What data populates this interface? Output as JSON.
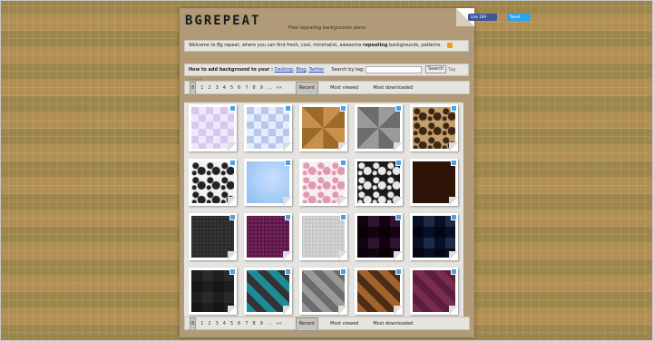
{
  "header": {
    "logo": "BGREPEAT",
    "tagline": "Free repeating backgrounds place"
  },
  "social": {
    "facebook": "Like 189",
    "twitter": "Tweet"
  },
  "welcome": {
    "prefix": "Welcome to Bg repeat, where you can find fresh, cool, minimalist, awesome",
    "bold": "repeating",
    "suffix": "backgrounds, patterns."
  },
  "howto": {
    "label": "How to add background to your :",
    "links": [
      "Desktop",
      "Blog",
      "Twitter"
    ],
    "search_label": "Search by tag:",
    "search_button": "Search",
    "tag_cloud": "Tag Cloud"
  },
  "pager": {
    "pages": [
      "8",
      "1",
      "2",
      "3",
      "4",
      "5",
      "6",
      "7",
      "8",
      "9",
      "...",
      "»»"
    ],
    "tabs": [
      "Recent",
      "Most viewed",
      "Most downloaded"
    ],
    "selected_tab": "Recent"
  },
  "tiles": [
    {
      "pattern": "diamond-lavender",
      "bg": "#d8c8f0",
      "fg": "#eee8fb"
    },
    {
      "pattern": "diamond-blue",
      "bg": "#b8c8ec",
      "fg": "#e4ecff"
    },
    {
      "pattern": "pinwheel-brown",
      "bg": "#9c6a2a",
      "fg": "#c89048"
    },
    {
      "pattern": "pinwheel-grey",
      "bg": "#6c6c6c",
      "fg": "#9a9a9a"
    },
    {
      "pattern": "floral-tan",
      "bg": "#c7a070",
      "fg": "#3a2814"
    },
    {
      "pattern": "floral-white",
      "bg": "#f2f2f2",
      "fg": "#222222"
    },
    {
      "pattern": "sky-blue",
      "bg": "#8fbdf0",
      "fg": "#c8e0ff"
    },
    {
      "pattern": "floral-pink",
      "bg": "#f7f0f0",
      "fg": "#e09ab0"
    },
    {
      "pattern": "lace-black",
      "bg": "#1a1a1a",
      "fg": "#e8e8e8"
    },
    {
      "pattern": "dark-brown",
      "bg": "#2d1406",
      "fg": "#3d1c0a"
    },
    {
      "pattern": "dark-grey",
      "bg": "#2a2a2a",
      "fg": "#3a3a3a"
    },
    {
      "pattern": "purple-dots",
      "bg": "#5a1846",
      "fg": "#7a2a64"
    },
    {
      "pattern": "light-grey",
      "bg": "#c7c7c7",
      "fg": "#d8d8d8"
    },
    {
      "pattern": "plum-check",
      "bg": "#2e1430",
      "fg": "#6a2c5c"
    },
    {
      "pattern": "navy-check",
      "bg": "#1c2a44",
      "fg": "#445c8c"
    },
    {
      "pattern": "grey-check",
      "bg": "#2a2a2a",
      "fg": "#b8b8b8"
    },
    {
      "pattern": "teal-stripe",
      "bg": "#1c8c98",
      "fg": "#333333"
    },
    {
      "pattern": "grey-stripe",
      "bg": "#9a9a9a",
      "fg": "#6c6c6c"
    },
    {
      "pattern": "brown-stripe",
      "bg": "#a2622c",
      "fg": "#4c2c14"
    },
    {
      "pattern": "mauve-stripe",
      "bg": "#7a2c50",
      "fg": "#5a1e3c"
    }
  ]
}
